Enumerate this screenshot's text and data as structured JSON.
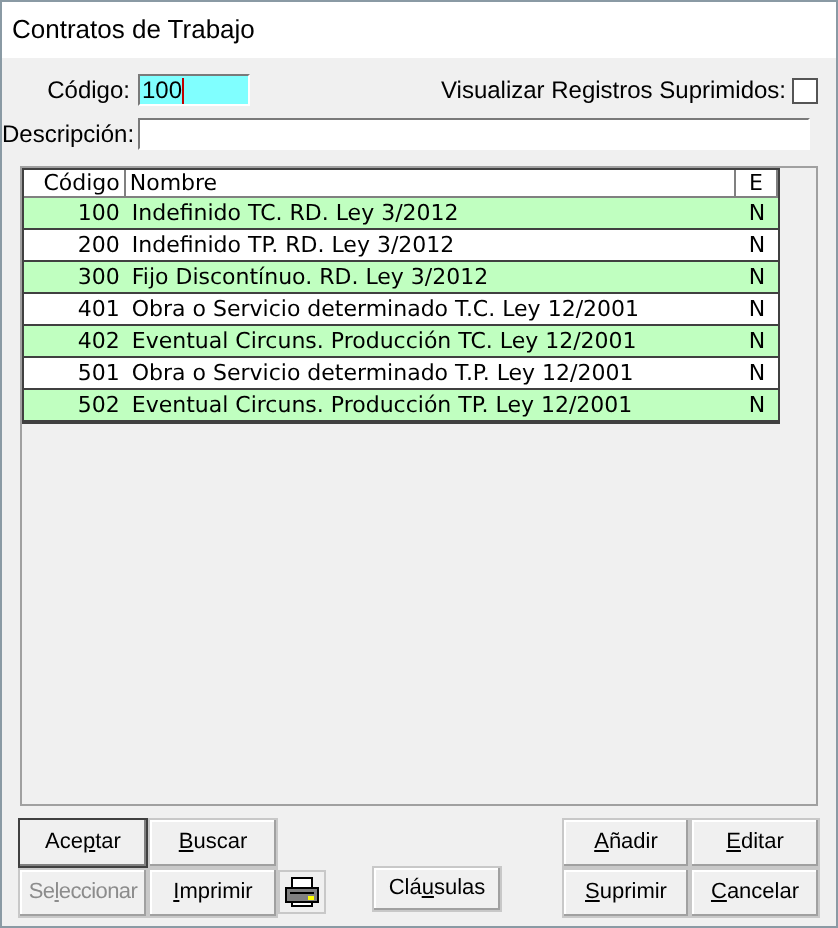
{
  "window": {
    "title": "Contratos de Trabajo"
  },
  "codigo": {
    "label": "Código:",
    "value": "100"
  },
  "show_deleted": {
    "label": "Visualizar Registros Suprimidos:",
    "checked": false
  },
  "descripcion": {
    "label": "Descripción:"
  },
  "table": {
    "columns": [
      "Código",
      "Nombre",
      "E"
    ],
    "rows": [
      {
        "code": "100",
        "name": "Indefinido TC. RD. Ley 3/2012",
        "e": "N"
      },
      {
        "code": "200",
        "name": "Indefinido TP. RD. Ley 3/2012",
        "e": "N"
      },
      {
        "code": "300",
        "name": "Fijo Discontínuo. RD. Ley 3/2012",
        "e": "N"
      },
      {
        "code": "401",
        "name": "Obra o Servicio determinado T.C. Ley 12/2001",
        "e": "N"
      },
      {
        "code": "402",
        "name": "Eventual Circuns. Producción TC. Ley 12/2001",
        "e": "N"
      },
      {
        "code": "501",
        "name": "Obra o Servicio determinado T.P. Ley 12/2001",
        "e": "N"
      },
      {
        "code": "502",
        "name": "Eventual Circuns. Producción TP. Ley 12/2001",
        "e": "N"
      }
    ]
  },
  "buttons": [
    {
      "pre": "Ace",
      "key": "p",
      "post": "tar",
      "default": true,
      "disabled": false
    },
    {
      "key": "B",
      "post": "uscar",
      "default": false,
      "disabled": false
    },
    {
      "key": "A",
      "post": "ñadir",
      "default": false,
      "disabled": false
    },
    {
      "key": "E",
      "post": "ditar",
      "default": false,
      "disabled": false
    },
    {
      "pre": "Se",
      "key": "l",
      "post": "eccionar",
      "default": false,
      "disabled": true
    },
    {
      "key": "I",
      "post": "mprimir",
      "default": false,
      "disabled": false
    },
    {
      "pre": "Clá",
      "key": "u",
      "post": "sulas",
      "default": false,
      "disabled": false
    },
    {
      "key": "S",
      "post": "uprimir",
      "default": false,
      "disabled": false
    },
    {
      "key": "C",
      "post": "ancelar",
      "default": false,
      "disabled": false
    }
  ]
}
